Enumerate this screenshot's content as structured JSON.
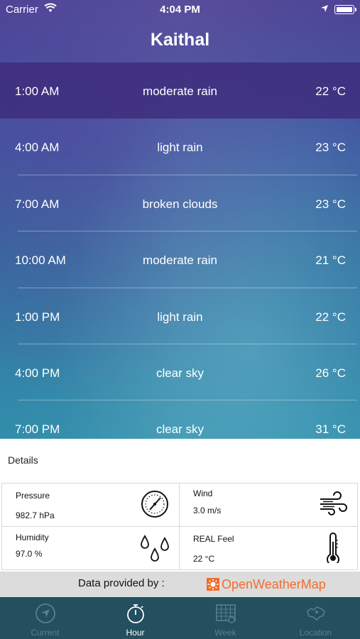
{
  "status_bar": {
    "carrier": "Carrier",
    "time": "4:04 PM"
  },
  "city": "Kaithal",
  "hours": [
    {
      "time": "1:00 AM",
      "desc": "moderate rain",
      "temp": "22 °C"
    },
    {
      "time": "4:00 AM",
      "desc": "light rain",
      "temp": "23 °C"
    },
    {
      "time": "7:00 AM",
      "desc": "broken clouds",
      "temp": "23 °C"
    },
    {
      "time": "10:00 AM",
      "desc": "moderate rain",
      "temp": "21 °C"
    },
    {
      "time": "1:00 PM",
      "desc": "light rain",
      "temp": "22 °C"
    },
    {
      "time": "4:00 PM",
      "desc": "clear sky",
      "temp": "26 °C"
    },
    {
      "time": "7:00 PM",
      "desc": "clear sky",
      "temp": "31 °C"
    }
  ],
  "details": {
    "title": "Details",
    "pressure": {
      "label": "Pressure",
      "value": "982.7 hPa",
      "icon": "barometer-icon"
    },
    "wind": {
      "label": "Wind",
      "value": "3.0 m/s",
      "icon": "wind-icon"
    },
    "humidity": {
      "label": "Humidity",
      "value": "97.0 %",
      "icon": "droplets-icon"
    },
    "real_feel": {
      "label": "REAL Feel",
      "value": "22 °C",
      "icon": "thermometer-icon"
    }
  },
  "attribution": {
    "text": "Data provided by :",
    "provider": "OpenWeatherMap",
    "provider_color": "#f26b2d"
  },
  "tabs": [
    {
      "label": "Current",
      "icon": "compass-icon",
      "active": false
    },
    {
      "label": "Hour",
      "icon": "stopwatch-icon",
      "active": true
    },
    {
      "label": "Week",
      "icon": "calendar-icon",
      "active": false
    },
    {
      "label": "Location",
      "icon": "map-icon",
      "active": false
    }
  ],
  "colors": {
    "tabbar_bg": "#234f5e",
    "tab_active": "#ffffff",
    "tab_inactive": "#5a7f8c",
    "selected_row": "#3c2878"
  }
}
